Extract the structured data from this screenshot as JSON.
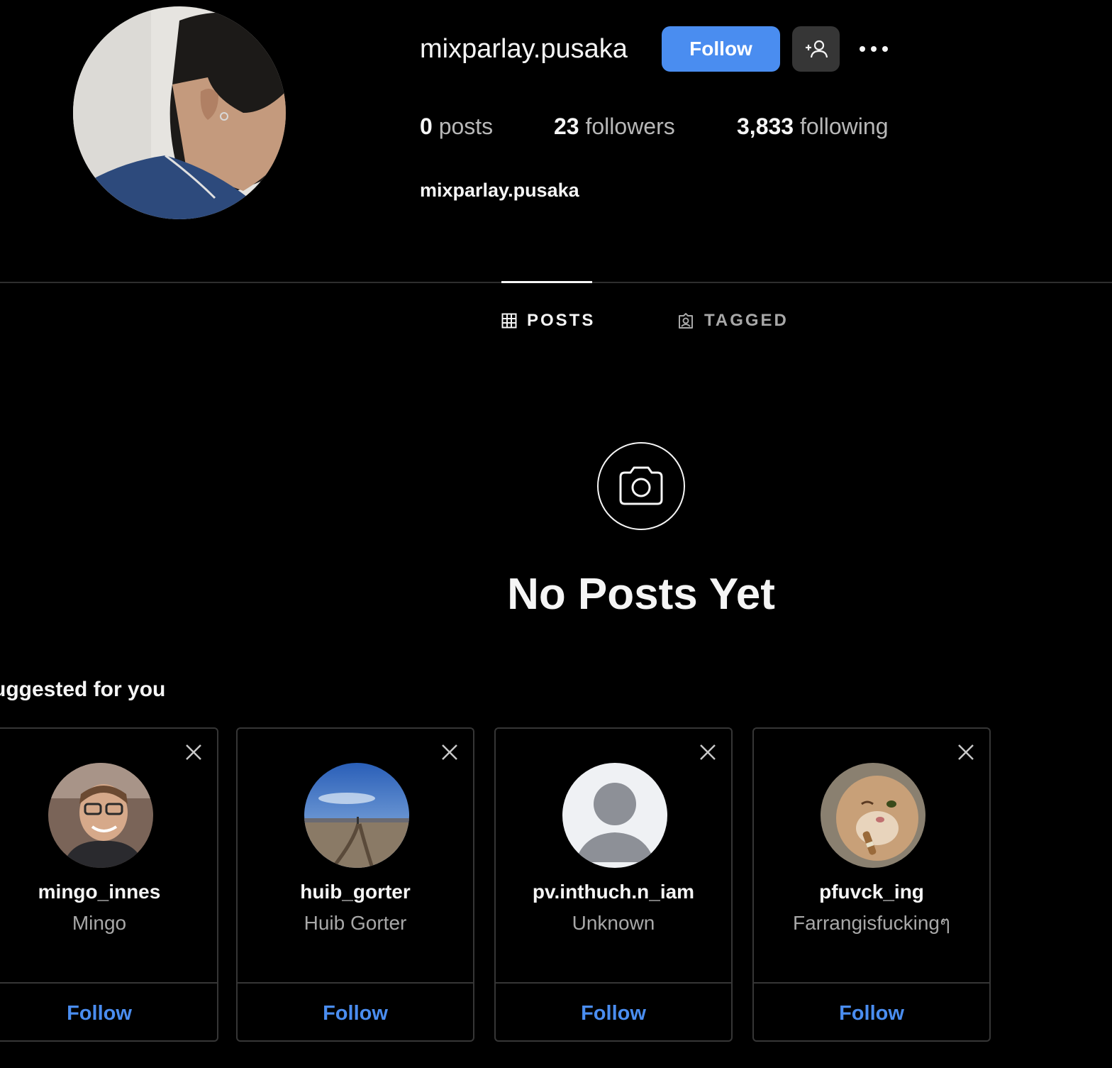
{
  "profile": {
    "username": "mixparlay.pusaka",
    "follow_label": "Follow",
    "posts_count": "0",
    "posts_label": "posts",
    "followers_count": "23",
    "followers_label": "followers",
    "following_count": "3,833",
    "following_label": "following",
    "full_name": "mixparlay.pusaka"
  },
  "tabs": [
    {
      "label": "POSTS",
      "icon": "grid-icon",
      "active": true
    },
    {
      "label": "TAGGED",
      "icon": "tagged-icon",
      "active": false
    }
  ],
  "empty_state": {
    "icon": "camera-icon",
    "title": "No Posts Yet"
  },
  "suggested": {
    "title": "uggested for you",
    "cards": [
      {
        "username": "mingo_innes",
        "name": "Mingo",
        "follow_label": "Follow"
      },
      {
        "username": "huib_gorter",
        "name": "Huib Gorter",
        "follow_label": "Follow"
      },
      {
        "username": "pv.inthuch.n_iam",
        "name": "Unknown",
        "follow_label": "Follow"
      },
      {
        "username": "pfuvck_ing",
        "name": "Farrangisfuckingๆ",
        "follow_label": "Follow"
      }
    ]
  },
  "colors": {
    "background": "#000000",
    "primary_button": "#4a8df0",
    "secondary_button": "#363636",
    "link_blue": "#4a8df0",
    "muted_text": "#a8a8a8",
    "border": "#363636"
  }
}
